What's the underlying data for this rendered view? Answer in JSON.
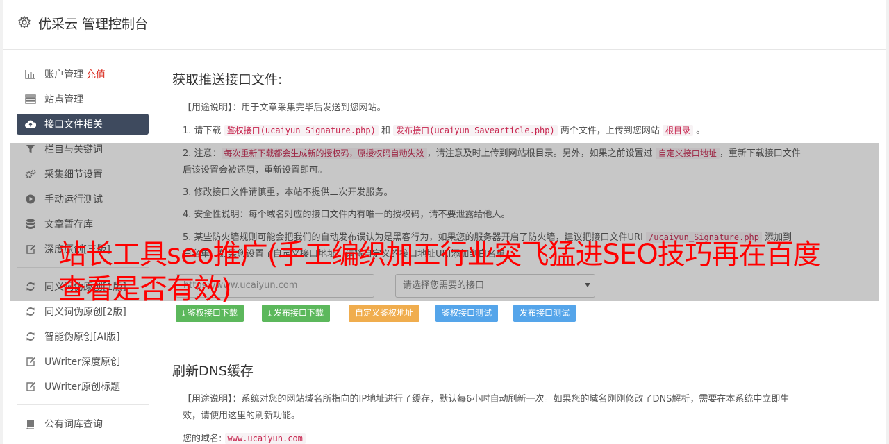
{
  "header": {
    "title": "优采云 管理控制台",
    "icon": "gear-icon"
  },
  "sidebar": {
    "items": [
      {
        "label": "账户管理",
        "badge": "充值",
        "icon": "bar-chart-icon"
      },
      {
        "label": "站点管理",
        "icon": "server-icon"
      },
      {
        "label": "接口文件相关",
        "icon": "cloud-upload-icon",
        "active": true
      },
      {
        "label": "栏目与关键词",
        "icon": "filter-icon"
      },
      {
        "label": "采集细节设置",
        "icon": "cogs-icon"
      },
      {
        "label": "手动运行测试",
        "icon": "play-circle-icon"
      },
      {
        "label": "文章暂存库",
        "icon": "database-icon"
      },
      {
        "label": "深度原创[三版]",
        "icon": "edit-icon"
      },
      {
        "label": "同义词伪原创[1版]",
        "icon": "refresh-icon"
      },
      {
        "label": "同义词伪原创[2版]",
        "icon": "refresh-icon"
      },
      {
        "label": "智能伪原创[AI版]",
        "icon": "refresh-icon"
      },
      {
        "label": "UWriter深度原创",
        "icon": "edit-icon"
      },
      {
        "label": "UWriter原创标题",
        "icon": "edit-icon"
      },
      {
        "label": "公有词库查询",
        "icon": "book-icon"
      }
    ]
  },
  "main": {
    "section1_title": "获取推送接口文件:",
    "usage_prefix": "【用途说明】：用于文章采集完毕后发送到您网站。",
    "step1": {
      "a": "1. 请下载 ",
      "code1": "鉴权接口(ucaiyun_Signature.php)",
      "b": " 和 ",
      "code2": "发布接口(ucaiyun_Savearticle.php)",
      "c": " 两个文件，上传到您网站 ",
      "code3": "根目录",
      "d": " 。"
    },
    "step2": {
      "a": "2. 注意：",
      "code1": "每次重新下载都会生成新的授权码，原授权码自动失效",
      "b": "，请注意及时上传到网站根目录。另外，如果之前设置过 ",
      "code2": "自定义接口地址",
      "c": "，重新下载接口文件后该设置会被还原，重新设置即可。"
    },
    "step3": "3. 修改接口文件请慎重，本站不提供二次开发服务。",
    "step4": "4. 安全性说明：每个域名对应的接口文件内有唯一的授权码，请不要泄露给他人。",
    "step5": {
      "a": "5. 某些防火墙规则可能会把我们的自动发布误认为是黑客行为，如果您的服务器开启了防火墙，建议把接口文件URI ",
      "code1": "/ucaiyun_Signature.php",
      "b": " 添加到白名单。如果您设置了自定义接口地址，请将自定义的接口地址URI添加到白名单。"
    },
    "url_placeholder": "https://www.ucaiyun.com",
    "select_placeholder": "请选择您需要的接口",
    "buttons": {
      "download_sig": "鉴权接口下载",
      "download_save": "发布接口下载",
      "custom_addr": "自定义鉴权地址",
      "test_sig": "鉴权接口测试",
      "test_save": "发布接口测试"
    },
    "section2_title": "刷新DNS缓存",
    "dns_usage": "【用途说明】：系统对您的网站域名所指向的IP地址进行了缓存，默认每6小时自动刷新一次。如果您的域名刚刚修改了DNS解析，需要在本系统中立即生效，请使用这里的刷新功能。",
    "domain_label": "您的域名:",
    "domain_value": "www.ucaiyun.com"
  },
  "overlay_ad": "站长工具seo推广(手工编织加工行业突飞猛进SEO技巧再在百度查看是否有效)"
}
